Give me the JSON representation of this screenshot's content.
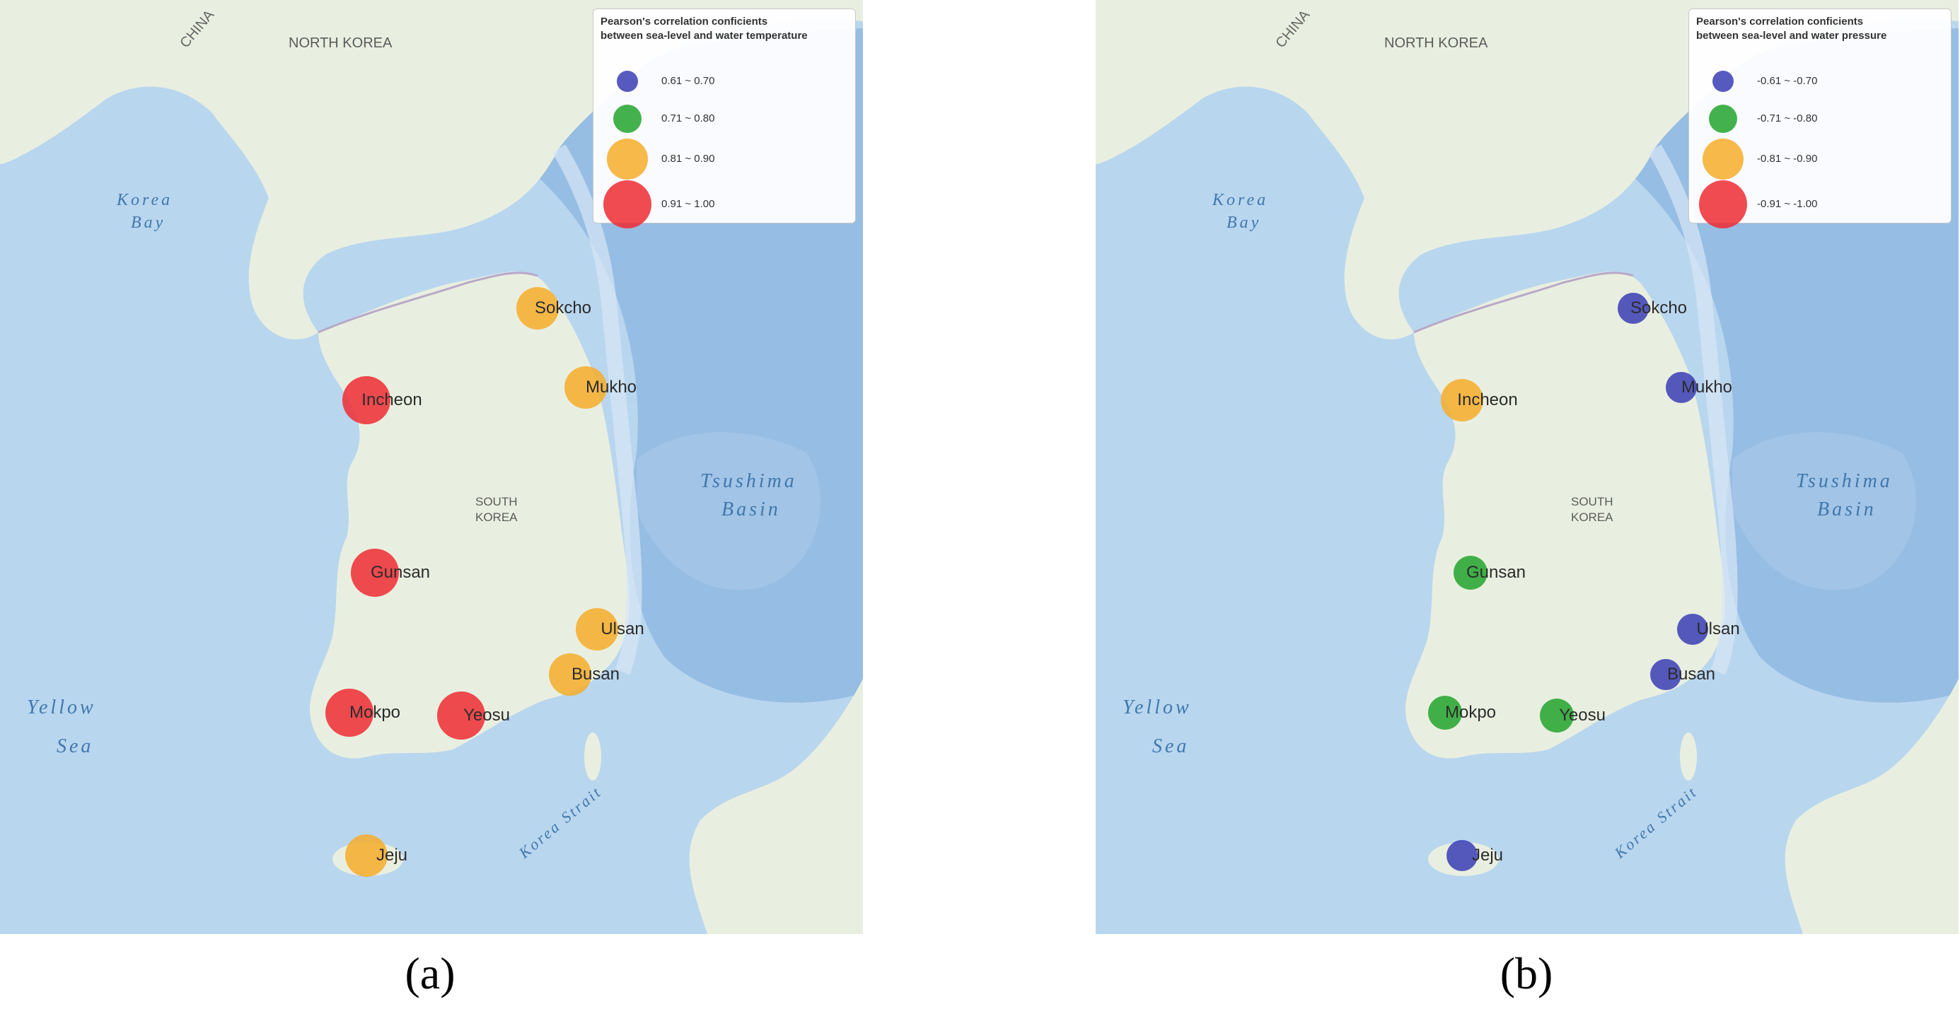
{
  "colors": {
    "blue": "#3a3db4",
    "green": "#23a32d",
    "orange": "#f6ad2a",
    "red": "#ee2b33",
    "sea": "#b9d6ef",
    "deep_sea": "#8fb8e0",
    "land": "#e9efe0"
  },
  "map_labels": {
    "china": "CHINA",
    "north_korea": "NORTH KOREA",
    "south_korea_1": "SOUTH",
    "south_korea_2": "KOREA",
    "korea_bay_1": "Korea",
    "korea_bay_2": "Bay",
    "yellow_sea_1": "Yellow",
    "yellow_sea_2": "Sea",
    "tsushima_1": "Tsushima",
    "tsushima_2": "Basin",
    "korea_strait": "Korea Strait"
  },
  "panels": [
    {
      "caption": "(a)",
      "legend": {
        "title_line1": "Pearson's correlation conficients",
        "title_line2": "between sea-level and water temperature",
        "classes": [
          {
            "label": "0.61 ~ 0.70",
            "color": "blue"
          },
          {
            "label": "0.71 ~ 0.80",
            "color": "green"
          },
          {
            "label": "0.81 ~ 0.90",
            "color": "orange"
          },
          {
            "label": "0.91 ~ 1.00",
            "color": "red"
          }
        ]
      },
      "stations": [
        {
          "name": "Sokcho",
          "class": 2
        },
        {
          "name": "Mukho",
          "class": 2
        },
        {
          "name": "Incheon",
          "class": 3
        },
        {
          "name": "Gunsan",
          "class": 3
        },
        {
          "name": "Ulsan",
          "class": 2
        },
        {
          "name": "Busan",
          "class": 2
        },
        {
          "name": "Mokpo",
          "class": 3
        },
        {
          "name": "Yeosu",
          "class": 3
        },
        {
          "name": "Jeju",
          "class": 2
        }
      ]
    },
    {
      "caption": "(b)",
      "legend": {
        "title_line1": "Pearson's correlation conficients",
        "title_line2": "between sea-level and water pressure",
        "classes": [
          {
            "label": "-0.61 ~ -0.70",
            "color": "blue"
          },
          {
            "label": "-0.71 ~ -0.80",
            "color": "green"
          },
          {
            "label": "-0.81 ~ -0.90",
            "color": "orange"
          },
          {
            "label": "-0.91 ~ -1.00",
            "color": "red"
          }
        ]
      },
      "stations": [
        {
          "name": "Sokcho",
          "class": 0
        },
        {
          "name": "Mukho",
          "class": 0
        },
        {
          "name": "Incheon",
          "class": 2
        },
        {
          "name": "Gunsan",
          "class": 1
        },
        {
          "name": "Ulsan",
          "class": 0
        },
        {
          "name": "Busan",
          "class": 0
        },
        {
          "name": "Mokpo",
          "class": 1
        },
        {
          "name": "Yeosu",
          "class": 1
        },
        {
          "name": "Jeju",
          "class": 0
        }
      ]
    }
  ]
}
